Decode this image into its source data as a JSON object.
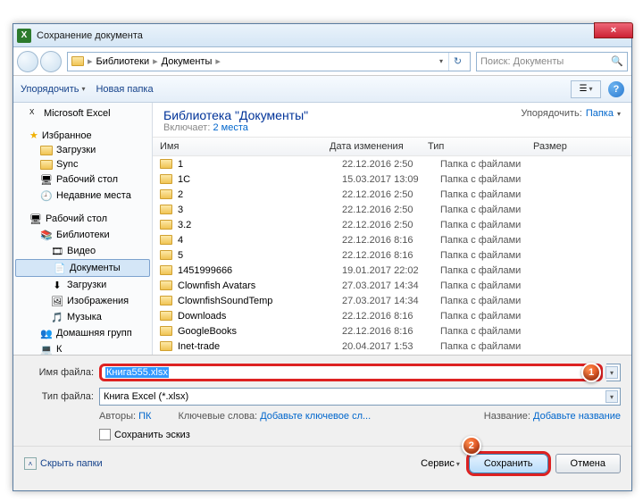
{
  "window": {
    "title": "Сохранение документа",
    "close": "×"
  },
  "nav": {
    "segments": [
      "Библиотеки",
      "Документы"
    ],
    "search_placeholder": "Поиск: Документы"
  },
  "toolbar": {
    "organize": "Упорядочить",
    "new_folder": "Новая папка"
  },
  "sidebar": {
    "excel": "Microsoft Excel",
    "favorites": "Избранное",
    "fav_items": [
      "Загрузки",
      "Sync",
      "Рабочий стол",
      "Недавние места"
    ],
    "desktop": "Рабочий стол",
    "libraries": "Библиотеки",
    "lib_items": [
      "Видео",
      "Документы",
      "Загрузки",
      "Изображения",
      "Музыка"
    ],
    "homegroup": "Домашняя групп",
    "computer_prefix": "К"
  },
  "library": {
    "title": "Библиотека \"Документы\"",
    "includes_label": "Включает:",
    "includes_link": "2 места",
    "arrange_label": "Упорядочить:",
    "arrange_value": "Папка"
  },
  "columns": {
    "name": "Имя",
    "date": "Дата изменения",
    "type": "Тип",
    "size": "Размер"
  },
  "files": [
    {
      "name": "1",
      "date": "22.12.2016 2:50",
      "type": "Папка с файлами"
    },
    {
      "name": "1C",
      "date": "15.03.2017 13:09",
      "type": "Папка с файлами"
    },
    {
      "name": "2",
      "date": "22.12.2016 2:50",
      "type": "Папка с файлами"
    },
    {
      "name": "3",
      "date": "22.12.2016 2:50",
      "type": "Папка с файлами"
    },
    {
      "name": "3.2",
      "date": "22.12.2016 2:50",
      "type": "Папка с файлами"
    },
    {
      "name": "4",
      "date": "22.12.2016 8:16",
      "type": "Папка с файлами"
    },
    {
      "name": "5",
      "date": "22.12.2016 8:16",
      "type": "Папка с файлами"
    },
    {
      "name": "1451999666",
      "date": "19.01.2017 22:02",
      "type": "Папка с файлами"
    },
    {
      "name": "Clownfish Avatars",
      "date": "27.03.2017 14:34",
      "type": "Папка с файлами"
    },
    {
      "name": "ClownfishSoundTemp",
      "date": "27.03.2017 14:34",
      "type": "Папка с файлами"
    },
    {
      "name": "Downloads",
      "date": "22.12.2016 8:16",
      "type": "Папка с файлами"
    },
    {
      "name": "GoogleBooks",
      "date": "22.12.2016 8:16",
      "type": "Папка с файлами"
    },
    {
      "name": "Inet-trade",
      "date": "20.04.2017 1:53",
      "type": "Папка с файлами"
    }
  ],
  "fields": {
    "filename_label": "Имя файла:",
    "filename_value": "Книга555.xlsx",
    "filetype_label": "Тип файла:",
    "filetype_value": "Книга Excel (*.xlsx)"
  },
  "meta": {
    "authors_label": "Авторы:",
    "authors_value": "ПК",
    "keywords_label": "Ключевые слова:",
    "keywords_link": "Добавьте ключевое сл...",
    "title_label": "Название:",
    "title_link": "Добавьте название",
    "thumb": "Сохранить эскиз"
  },
  "buttons": {
    "hide_folders": "Скрыть папки",
    "tools": "Сервис",
    "save": "Сохранить",
    "cancel": "Отмена"
  },
  "callouts": {
    "one": "1",
    "two": "2"
  }
}
